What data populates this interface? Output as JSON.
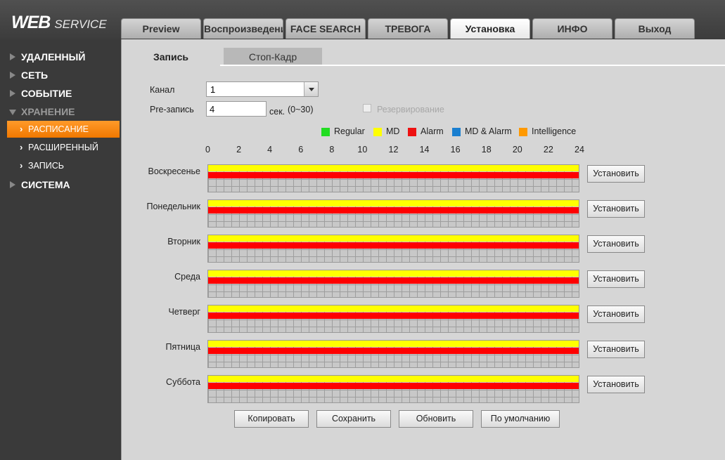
{
  "header": {
    "logo_main": "WEB",
    "logo_sub": "SERVICE",
    "tabs": [
      {
        "label": "Preview"
      },
      {
        "label": "Воспроизведение"
      },
      {
        "label": "FACE SEARCH"
      },
      {
        "label": "ТРЕВОГА"
      },
      {
        "label": "Установка",
        "active": true
      },
      {
        "label": "ИНФО"
      },
      {
        "label": "Выход"
      }
    ]
  },
  "sidebar": {
    "items": [
      {
        "label": "УДАЛЕННЫЙ"
      },
      {
        "label": "СЕТЬ"
      },
      {
        "label": "СОБЫТИЕ"
      },
      {
        "label": "ХРАНЕНИЕ",
        "expanded": true
      },
      {
        "label": "РАСПИСАНИЕ",
        "active": true
      },
      {
        "label": "РАСШИРЕННЫЙ"
      },
      {
        "label": "ЗАПИСЬ"
      },
      {
        "label": "СИСТЕМА"
      }
    ]
  },
  "subtabs": [
    {
      "label": "Запись",
      "active": true
    },
    {
      "label": "Стоп-Кадр"
    }
  ],
  "form": {
    "channel_label": "Канал",
    "channel_value": "1",
    "prerecord_label": "Pre-запись",
    "prerecord_value": "4",
    "prerecord_unit": "сек.",
    "prerecord_range": "(0~30)",
    "backup_label": "Резервирование",
    "backup_checked": false
  },
  "legend": [
    {
      "label": "Regular",
      "color": "#22dd22"
    },
    {
      "label": "MD",
      "color": "#ffff00"
    },
    {
      "label": "Alarm",
      "color": "#ee1111"
    },
    {
      "label": "MD & Alarm",
      "color": "#1a7fd0"
    },
    {
      "label": "Intelligence",
      "color": "#ff9900"
    }
  ],
  "timeline": {
    "ticks": [
      "0",
      "2",
      "4",
      "6",
      "8",
      "10",
      "12",
      "14",
      "16",
      "18",
      "20",
      "22",
      "24"
    ],
    "range": [
      0,
      24
    ]
  },
  "days": [
    {
      "name": "Воскресенье",
      "md": [
        0,
        24
      ],
      "alarm": [
        0,
        24
      ]
    },
    {
      "name": "Понедельник",
      "md": [
        0,
        24
      ],
      "alarm": [
        0,
        24
      ]
    },
    {
      "name": "Вторник",
      "md": [
        0,
        24
      ],
      "alarm": [
        0,
        24
      ]
    },
    {
      "name": "Среда",
      "md": [
        0,
        24
      ],
      "alarm": [
        0,
        24
      ]
    },
    {
      "name": "Четверг",
      "md": [
        0,
        24
      ],
      "alarm": [
        0,
        24
      ]
    },
    {
      "name": "Пятница",
      "md": [
        0,
        24
      ],
      "alarm": [
        0,
        24
      ]
    },
    {
      "name": "Суббота",
      "md": [
        0,
        24
      ],
      "alarm": [
        0,
        24
      ]
    }
  ],
  "set_button_label": "Установить",
  "buttons": {
    "copy": "Копировать",
    "save": "Сохранить",
    "refresh": "Обновить",
    "default": "По умолчанию"
  }
}
